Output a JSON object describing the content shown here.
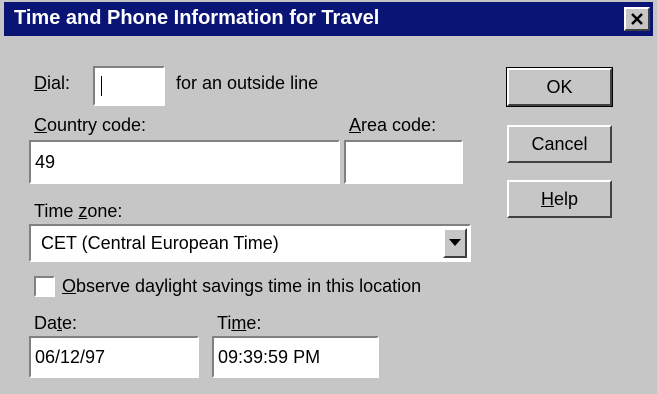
{
  "window": {
    "title": "Time and Phone Information for Travel",
    "close_label": "×"
  },
  "dial": {
    "label_key": "D",
    "label_rest": "ial:",
    "value": "",
    "suffix": "for an outside line"
  },
  "country_code": {
    "label_key": "C",
    "label_rest": "ountry code:",
    "value": "49"
  },
  "area_code": {
    "label_key": "A",
    "label_rest": "rea code:",
    "value": ""
  },
  "time_zone": {
    "label_pre": "Time ",
    "label_key": "z",
    "label_rest": "one:",
    "selected": "CET (Central European Time)",
    "icon": "dropdown-arrow-icon"
  },
  "daylight": {
    "checked": false,
    "label_key": "O",
    "label_rest": "bserve daylight savings time in this location"
  },
  "date": {
    "label_pre": "Da",
    "label_key": "t",
    "label_rest": "e:",
    "value": "06/12/97"
  },
  "time": {
    "label_pre": "Ti",
    "label_key": "m",
    "label_rest": "e:",
    "value": "09:39:59 PM"
  },
  "buttons": {
    "ok": "OK",
    "cancel": "Cancel",
    "help_key": "H",
    "help_rest": "elp"
  },
  "colors": {
    "titlebar": "#0a1475",
    "face": "#c6c6c6"
  }
}
